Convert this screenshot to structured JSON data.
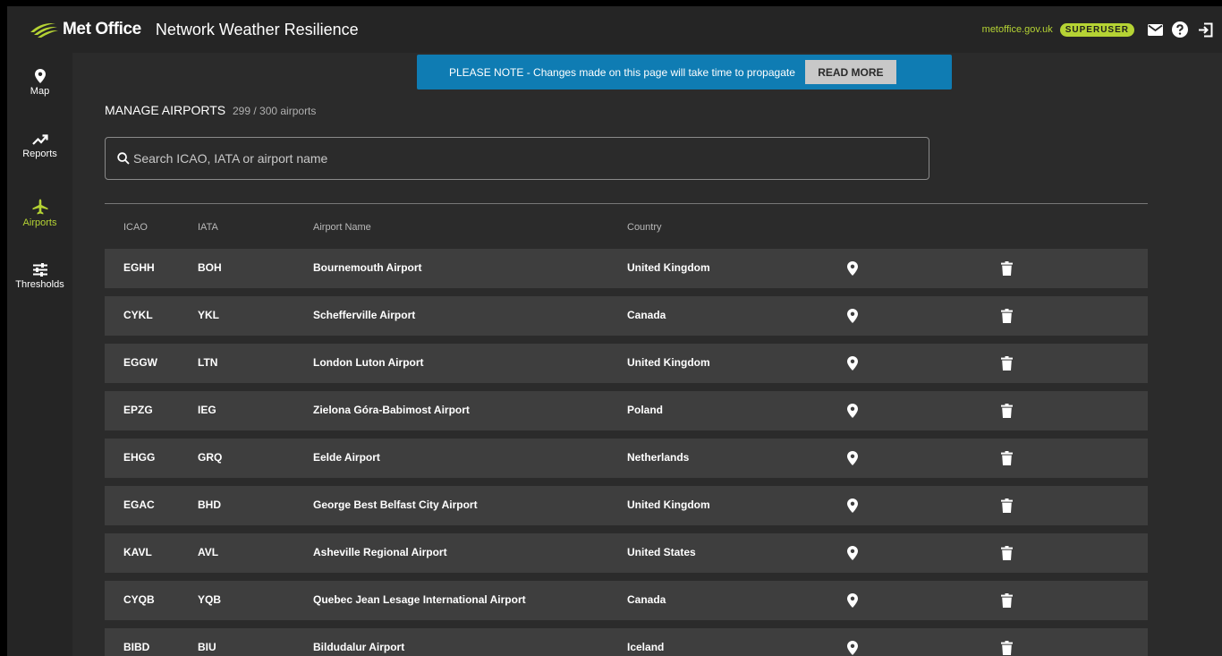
{
  "header": {
    "brand": "Met Office",
    "app_title": "Network Weather Resilience",
    "site_link": "metoffice.gov.uk",
    "role_badge": "SUPERUSER",
    "icons": [
      "mail-icon",
      "help-icon",
      "logout-icon"
    ]
  },
  "sidebar": {
    "items": [
      {
        "label": "Map",
        "icon": "map-pin-icon",
        "active": false
      },
      {
        "label": "Reports",
        "icon": "trend-icon",
        "active": false
      },
      {
        "label": "Airports",
        "icon": "airplane-icon",
        "active": true
      },
      {
        "label": "Thresholds",
        "icon": "sliders-icon",
        "active": false
      }
    ]
  },
  "notice": {
    "text": "PLEASE NOTE - Changes made on this page will take time to propagate",
    "button": "READ MORE"
  },
  "page": {
    "title": "MANAGE AIRPORTS",
    "count": "299 / 300 airports"
  },
  "search": {
    "placeholder": "Search ICAO, IATA or airport name",
    "value": ""
  },
  "table": {
    "columns": [
      "ICAO",
      "IATA",
      "Airport Name",
      "Country"
    ],
    "rows": [
      {
        "icao": "EGHH",
        "iata": "BOH",
        "name": "Bournemouth Airport",
        "country": "United Kingdom"
      },
      {
        "icao": "CYKL",
        "iata": "YKL",
        "name": "Schefferville Airport",
        "country": "Canada"
      },
      {
        "icao": "EGGW",
        "iata": "LTN",
        "name": "London Luton Airport",
        "country": "United Kingdom"
      },
      {
        "icao": "EPZG",
        "iata": "IEG",
        "name": "Zielona Góra-Babimost Airport",
        "country": "Poland"
      },
      {
        "icao": "EHGG",
        "iata": "GRQ",
        "name": "Eelde Airport",
        "country": "Netherlands"
      },
      {
        "icao": "EGAC",
        "iata": "BHD",
        "name": "George Best Belfast City Airport",
        "country": "United Kingdom"
      },
      {
        "icao": "KAVL",
        "iata": "AVL",
        "name": "Asheville Regional Airport",
        "country": "United States"
      },
      {
        "icao": "CYQB",
        "iata": "YQB",
        "name": "Quebec Jean Lesage International Airport",
        "country": "Canada"
      },
      {
        "icao": "BIBD",
        "iata": "BIU",
        "name": "Bildudalur Airport",
        "country": "Iceland"
      }
    ],
    "row_actions": [
      "locate-pin-icon",
      "delete-trash-icon"
    ]
  },
  "colors": {
    "accent": "#b5d334",
    "notice_bg": "#0f7cb3",
    "row_bg": "#3e3e3e",
    "page_bg": "#2b2b2b",
    "chrome_bg": "#252525"
  }
}
